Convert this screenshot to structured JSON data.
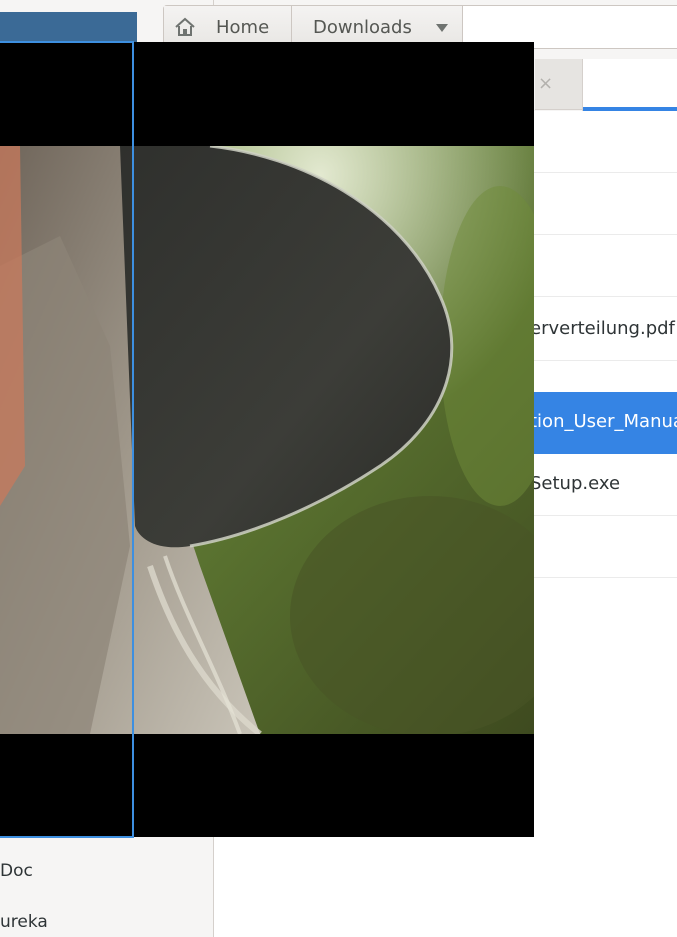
{
  "pathbar": {
    "home_label": "Home",
    "downloads_label": "Downloads"
  },
  "tabs": {
    "close_glyph": "×"
  },
  "sidebar": {
    "items": [
      {
        "label": "Doc"
      },
      {
        "label": "ureka"
      }
    ]
  },
  "files": [
    {
      "name": ""
    },
    {
      "name": ""
    },
    {
      "name": ""
    },
    {
      "name": "erverteilung.pdf"
    },
    {
      "name": "tion_User_Manua",
      "selected": true
    },
    {
      "name": "Setup.exe"
    },
    {
      "name": ""
    }
  ],
  "colors": {
    "selection_blue": "#3584e4",
    "video_background": "#000000"
  },
  "icons": {
    "home": "home-icon",
    "dropdown": "pan-down-icon",
    "close": "close-icon"
  }
}
